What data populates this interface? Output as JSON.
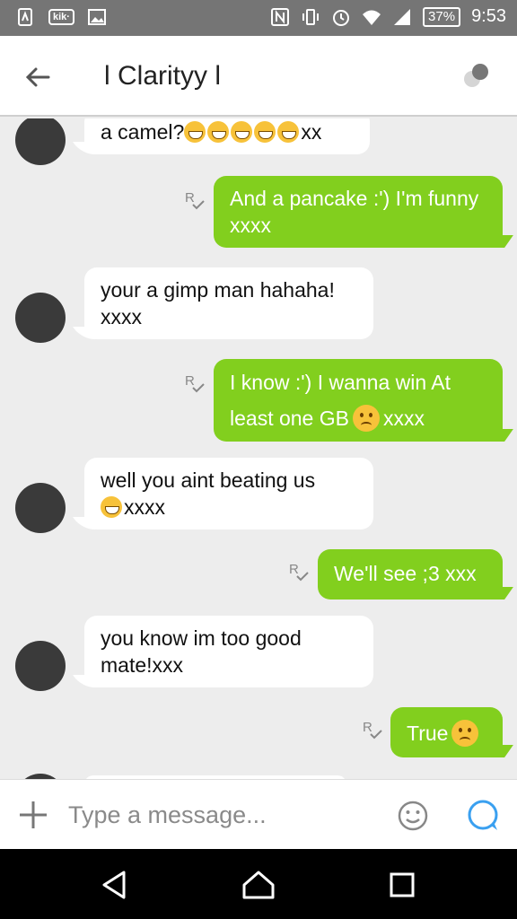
{
  "status_bar": {
    "app_badge": "kik·",
    "battery": "37%",
    "time": "9:53"
  },
  "header": {
    "title": "l Clarityy l"
  },
  "messages": [
    {
      "side": "in",
      "text": "a camel?",
      "emoji": "grin×5",
      "suffix": "xx"
    },
    {
      "side": "out",
      "text": "And a pancake :') I'm funny xxxx",
      "receipt": "R"
    },
    {
      "side": "in",
      "text": "your a gimp man hahaha! xxxx"
    },
    {
      "side": "out",
      "text_a": "I know :') I wanna win At least one GB",
      "text_b": "xxxx",
      "emoji": "disappointed",
      "receipt": "R"
    },
    {
      "side": "in",
      "text_a": "well you aint beating us",
      "text_b": "xxxx",
      "emoji": "grin"
    },
    {
      "side": "out",
      "text": "We'll see ;3 xxx",
      "receipt": "R"
    },
    {
      "side": "in",
      "text": "you know im too good mate!xxx"
    },
    {
      "side": "out",
      "text": "True",
      "emoji": "disappointed-relieved",
      "receipt": "R"
    }
  ],
  "compose": {
    "placeholder": "Type a message..."
  },
  "colors": {
    "outgoing_bubble": "#82cf1e",
    "incoming_bubble": "#ffffff",
    "send_icon": "#3aa0f0"
  }
}
